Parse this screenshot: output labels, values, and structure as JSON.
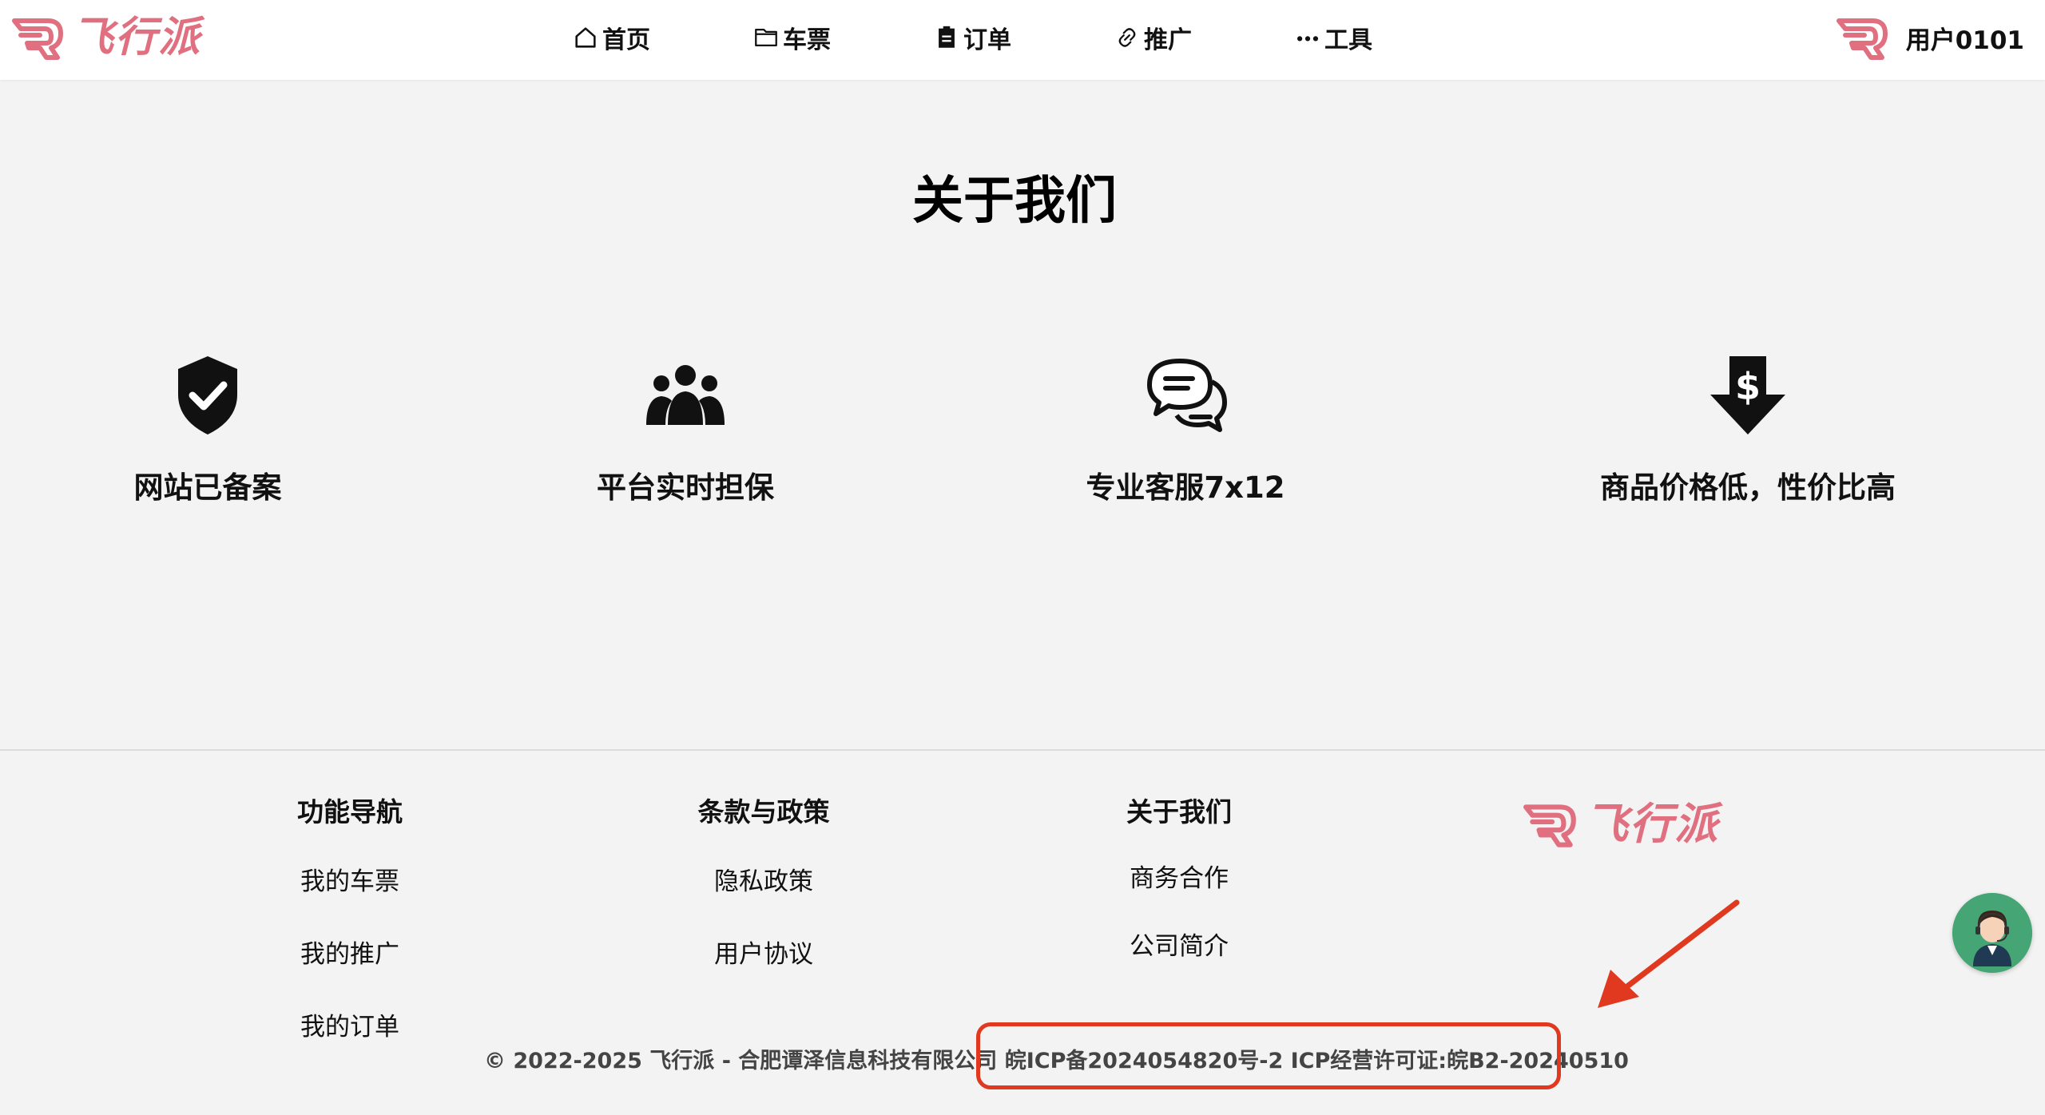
{
  "header": {
    "brand": "飞行派",
    "nav": [
      {
        "label": "首页",
        "icon": "home-icon"
      },
      {
        "label": "车票",
        "icon": "folder-icon"
      },
      {
        "label": "订单",
        "icon": "clipboard-icon"
      },
      {
        "label": "推广",
        "icon": "link-icon"
      },
      {
        "label": "工具",
        "icon": "more-dots-icon"
      }
    ],
    "user_name": "用户0101"
  },
  "about": {
    "title": "关于我们",
    "features": [
      {
        "label": "网站已备案",
        "icon": "shield-check-icon"
      },
      {
        "label": "平台实时担保",
        "icon": "group-people-icon"
      },
      {
        "label": "专业客服7x12",
        "icon": "chat-bubbles-icon"
      },
      {
        "label": "商品价格低，性价比高",
        "icon": "dollar-down-arrow-icon"
      }
    ]
  },
  "footer": {
    "columns": [
      {
        "title": "功能导航",
        "links": [
          "我的车票",
          "我的推广",
          "我的订单"
        ]
      },
      {
        "title": "条款与政策",
        "links": [
          "隐私政策",
          "用户协议"
        ]
      },
      {
        "title": "关于我们",
        "links": [
          "商务合作",
          "公司简介"
        ]
      }
    ],
    "logo_text": "飞行派",
    "copyright": "© 2022-2025 飞行派 - 合肥谭泽信息科技有限公司 ",
    "icp": "皖ICP备2024054820号-2 ICP经营许可证:皖B2-20240510"
  },
  "colors": {
    "brand": "#e07080",
    "highlight": "#e0391f",
    "chat_button": "#45a575",
    "background": "#f3f3f3"
  }
}
